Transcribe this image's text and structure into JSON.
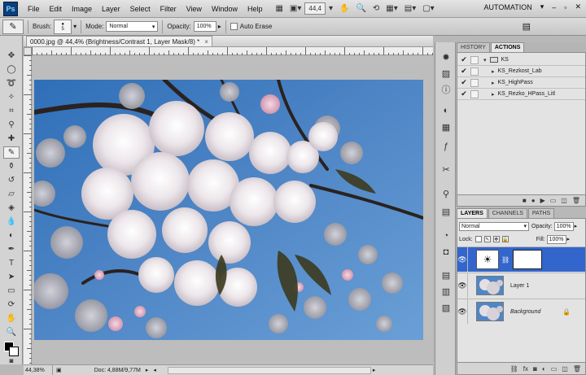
{
  "app": {
    "logo": "Ps"
  },
  "menu": [
    "File",
    "Edit",
    "Image",
    "Layer",
    "Select",
    "Filter",
    "View",
    "Window",
    "Help"
  ],
  "menubar": {
    "zoom_value": "44,4",
    "workspace": "AUTOMATION"
  },
  "options_bar": {
    "brush_label": "Brush:",
    "brush_size": "5",
    "mode_label": "Mode:",
    "mode_value": "Normal",
    "opacity_label": "Opacity:",
    "opacity_value": "100%",
    "auto_erase_label": "Auto Erase"
  },
  "document": {
    "tab_title": "0000.jpg @ 44,4% (Brightness/Contrast 1, Layer Mask/8) *",
    "close_glyph": "×"
  },
  "status": {
    "zoom": "44,38%",
    "doc": "Doc: 4,88M/9,77M"
  },
  "panels": {
    "top_tabs": [
      "HISTORY",
      "ACTIONS"
    ],
    "actions": [
      {
        "label": "KS",
        "kind": "set"
      },
      {
        "label": "KS_Rezkost_Lab",
        "kind": "action"
      },
      {
        "label": "KS_HighPass",
        "kind": "action"
      },
      {
        "label": "KS_Rezko_HPass_Litl",
        "kind": "action"
      }
    ],
    "layer_tabs": [
      "LAYERS",
      "CHANNELS",
      "PATHS"
    ],
    "layers": {
      "blend_mode": "Normal",
      "opacity_label": "Opacity:",
      "opacity_value": "100%",
      "lock_label": "Lock:",
      "fill_label": "Fill:",
      "fill_value": "100%",
      "items": [
        {
          "name": "",
          "kind": "adjustment",
          "selected": true
        },
        {
          "name": "Layer 1",
          "kind": "image",
          "selected": false
        },
        {
          "name": "Background",
          "kind": "image",
          "selected": false,
          "locked": true
        }
      ]
    }
  },
  "colors": {
    "selection": "#3366cc",
    "sky": "#4f86c6",
    "panel": "#e3e3e3",
    "chrome": "#c9c9c9"
  }
}
